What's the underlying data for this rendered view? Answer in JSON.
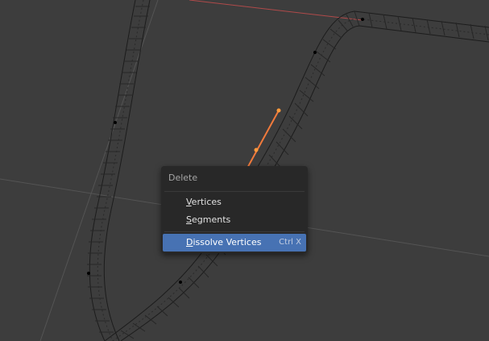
{
  "context_menu": {
    "title": "Delete",
    "items": [
      {
        "label_first": "V",
        "label_rest": "ertices",
        "shortcut": "",
        "active": false
      },
      {
        "label_first": "S",
        "label_rest": "egments",
        "shortcut": "",
        "active": false
      },
      {
        "label_first": "D",
        "label_rest": "issolve Vertices",
        "shortcut": "Ctrl X",
        "active": true
      }
    ]
  },
  "colors": {
    "background": "#3d3d3d",
    "grid_line": "#545454",
    "x_axis": "#b04a4a",
    "curve_wire": "#1c1c1c",
    "selected_segment": "#f07a3c",
    "menu_bg": "#282828",
    "highlight": "#4772b3"
  }
}
